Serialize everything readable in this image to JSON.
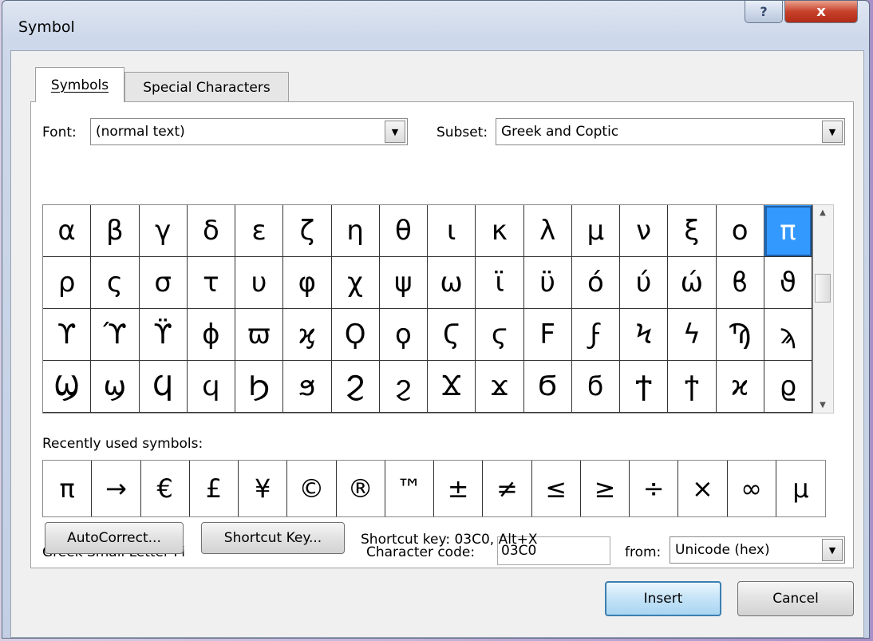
{
  "window": {
    "title": "Symbol",
    "help_label": "?",
    "close_label": "x"
  },
  "tabs": [
    {
      "label": "Symbols",
      "selected": true
    },
    {
      "label": "Special Characters",
      "selected": false
    }
  ],
  "font": {
    "label": "Font:",
    "value": "(normal text)"
  },
  "subset": {
    "label": "Subset:",
    "value": "Greek and Coptic"
  },
  "symbol_grid": {
    "selected": "π",
    "rows": [
      [
        "α",
        "β",
        "γ",
        "δ",
        "ε",
        "ζ",
        "η",
        "θ",
        "ι",
        "κ",
        "λ",
        "μ",
        "ν",
        "ξ",
        "ο",
        "π"
      ],
      [
        "ρ",
        "ς",
        "σ",
        "τ",
        "υ",
        "φ",
        "χ",
        "ψ",
        "ω",
        "ϊ",
        "ϋ",
        "ό",
        "ύ",
        "ώ",
        "ϐ",
        "ϑ"
      ],
      [
        "ϒ",
        "ϓ",
        "ϔ",
        "ϕ",
        "ϖ",
        "ϗ",
        "Ϙ",
        "ϙ",
        "Ϛ",
        "ϛ",
        "Ϝ",
        "ϝ",
        "Ϟ",
        "ϟ",
        "Ϡ",
        "ϡ"
      ],
      [
        "Ϣ",
        "ϣ",
        "Ϥ",
        "ϥ",
        "Ϧ",
        "ϧ",
        "Ϩ",
        "ϩ",
        "Ϫ",
        "ϫ",
        "Ϭ",
        "ϭ",
        "Ϯ",
        "ϯ",
        "ϰ",
        "ϱ"
      ]
    ]
  },
  "recent": {
    "label": "Recently used symbols:",
    "symbols": [
      "π",
      "→",
      "€",
      "£",
      "¥",
      "©",
      "®",
      "™",
      "±",
      "≠",
      "≤",
      "≥",
      "÷",
      "×",
      "∞",
      "μ"
    ]
  },
  "char_name": "Greek Small Letter Pi",
  "char_code": {
    "label": "Character code:",
    "value": "03C0"
  },
  "from": {
    "label": "from:",
    "value": "Unicode (hex)"
  },
  "buttons": {
    "autocorrect": "AutoCorrect...",
    "shortcut_key": "Shortcut Key...",
    "insert": "Insert",
    "cancel": "Cancel"
  },
  "shortcut_text": "Shortcut key: 03C0, Alt+X"
}
